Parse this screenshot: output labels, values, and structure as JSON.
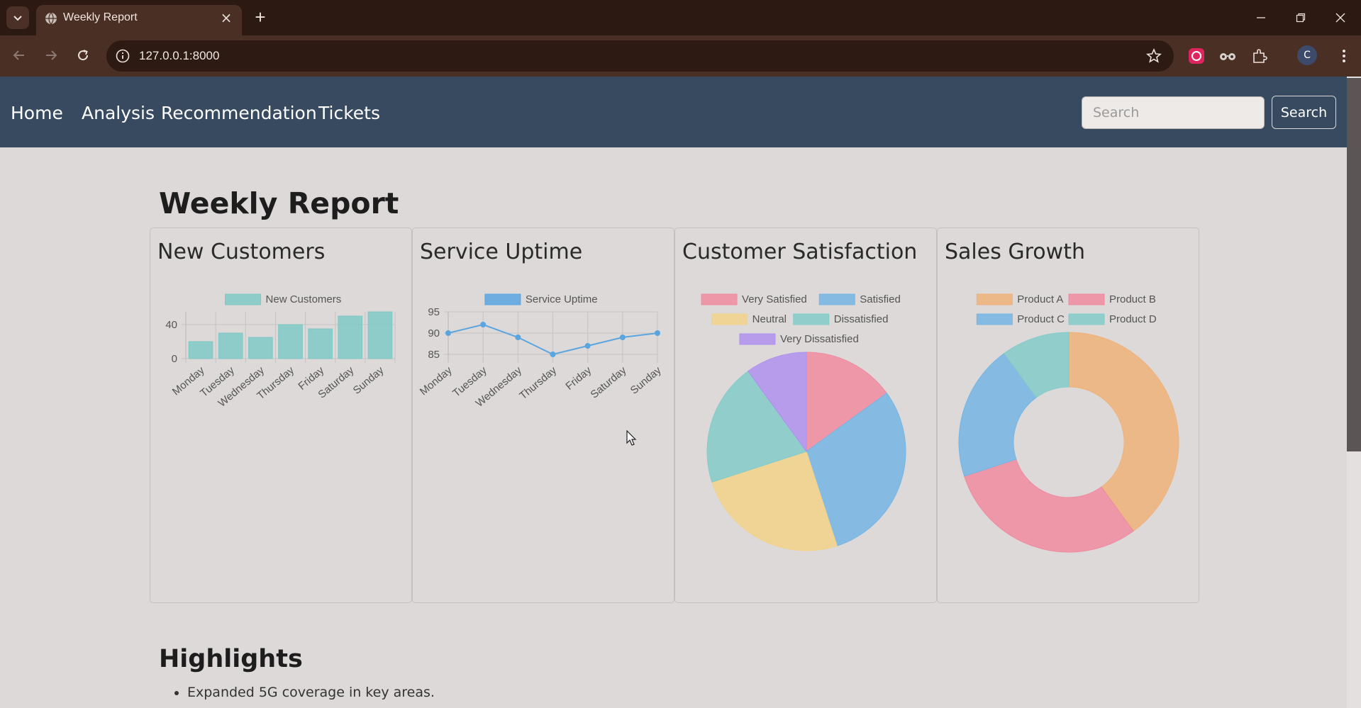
{
  "browser": {
    "tab_title": "Weekly Report",
    "url": "127.0.0.1:8000",
    "profile_initial": "C"
  },
  "nav": {
    "links": [
      "Home",
      "Analysis",
      "Recommendation",
      "Tickets"
    ],
    "search_placeholder": "Search",
    "search_button": "Search"
  },
  "page": {
    "title": "Weekly Report",
    "highlights_title": "Highlights",
    "highlights": [
      "Expanded 5G coverage in key areas."
    ]
  },
  "cards": [
    "New Customers",
    "Service Uptime",
    "Customer Satisfaction",
    "Sales Growth"
  ],
  "chart_data": [
    {
      "type": "bar",
      "categories": [
        "Monday",
        "Tuesday",
        "Wednesday",
        "Thursday",
        "Friday",
        "Saturday",
        "Sunday"
      ],
      "series": [
        {
          "name": "New Customers",
          "values": [
            20,
            30,
            25,
            40,
            35,
            50,
            55
          ],
          "color": "#7fc9c7"
        }
      ],
      "yticks": [
        0,
        40
      ],
      "ylim": [
        0,
        55
      ]
    },
    {
      "type": "line",
      "categories": [
        "Monday",
        "Tuesday",
        "Wednesday",
        "Thursday",
        "Friday",
        "Saturday",
        "Sunday"
      ],
      "series": [
        {
          "name": "Service Uptime",
          "values": [
            90,
            92,
            89,
            85,
            87,
            89,
            90
          ],
          "color": "#5aa5e0"
        }
      ],
      "yticks": [
        85,
        90,
        95
      ],
      "ylim": [
        84,
        95
      ]
    },
    {
      "type": "pie",
      "labels": [
        "Very Satisfied",
        "Satisfied",
        "Neutral",
        "Dissatisfied",
        "Very Dissatisfied"
      ],
      "values": [
        15,
        30,
        25,
        20,
        10
      ],
      "colors": [
        "#f08ba0",
        "#76b5e4",
        "#f2d28a",
        "#84cbc9",
        "#b091ef"
      ]
    },
    {
      "type": "pie",
      "doughnut": true,
      "labels": [
        "Product A",
        "Product B",
        "Product C",
        "Product D"
      ],
      "values": [
        40,
        30,
        20,
        10
      ],
      "colors": [
        "#f0b17a",
        "#f08ba0",
        "#76b5e4",
        "#84cbc9"
      ]
    }
  ]
}
